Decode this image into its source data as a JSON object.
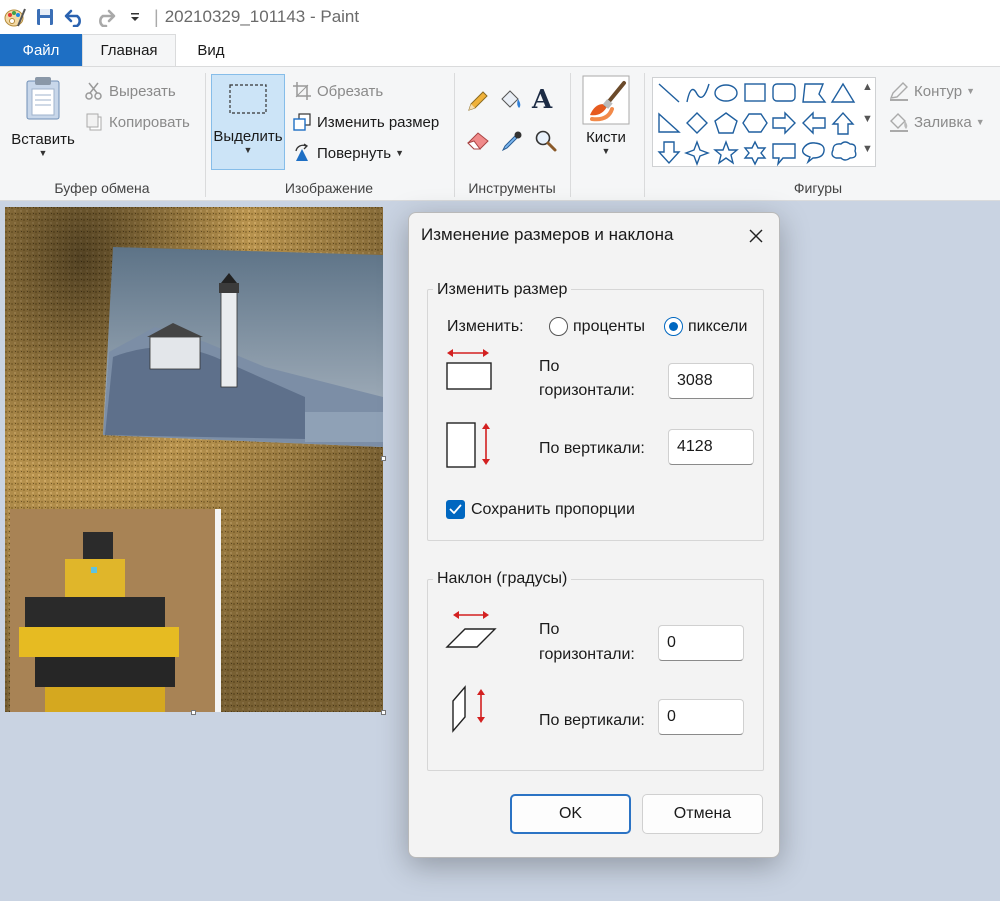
{
  "window": {
    "title": "20210329_101143 - Paint"
  },
  "tabs": {
    "file": "Файл",
    "home": "Главная",
    "view": "Вид"
  },
  "ribbon": {
    "clipboard": {
      "paste": "Вставить",
      "cut": "Вырезать",
      "copy": "Копировать",
      "label": "Буфер обмена"
    },
    "image": {
      "select": "Выделить",
      "crop": "Обрезать",
      "resize": "Изменить размер",
      "rotate": "Повернуть",
      "label": "Изображение"
    },
    "tools": {
      "label": "Инструменты"
    },
    "brushes": {
      "label": "Кисти"
    },
    "shapes": {
      "outline": "Контур",
      "fill": "Заливка",
      "label": "Фигуры"
    }
  },
  "dialog": {
    "title": "Изменение размеров и наклона",
    "resize_group": "Изменить размер",
    "by_label": "Изменить:",
    "percent": "проценты",
    "pixels": "пиксели",
    "horizontal_label_1": "По",
    "horizontal_label_2": "горизонтали:",
    "vertical_label": "По вертикали:",
    "width_value": "3088",
    "height_value": "4128",
    "keep_ratio": "Сохранить пропорции",
    "skew_group": "Наклон (градусы)",
    "skew_h_value": "0",
    "skew_v_value": "0",
    "ok": "OK",
    "cancel": "Отмена"
  },
  "colors": {
    "accent": "#0067c0",
    "file_tab": "#1e6fc4",
    "workspace": "#c9d3e2"
  }
}
